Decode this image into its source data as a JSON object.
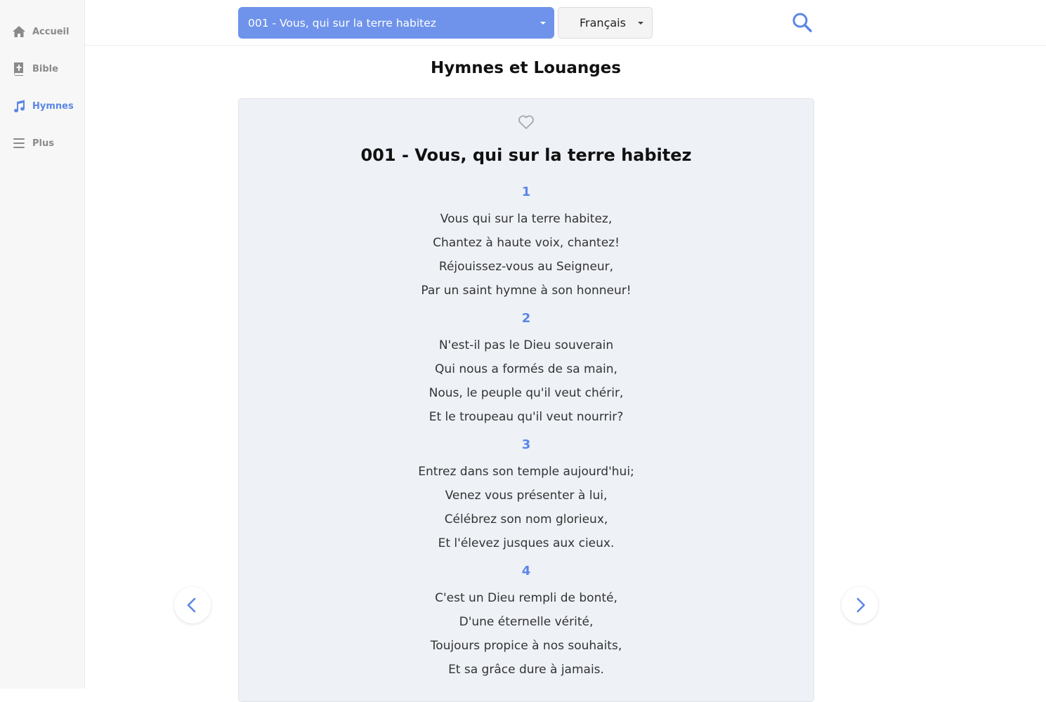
{
  "sidebar": {
    "items": [
      {
        "label": "Accueil",
        "icon": "home-icon",
        "active": false
      },
      {
        "label": "Bible",
        "icon": "bible-icon",
        "active": false
      },
      {
        "label": "Hymnes",
        "icon": "music-note-icon",
        "active": true
      },
      {
        "label": "Plus",
        "icon": "menu-icon",
        "active": false
      }
    ]
  },
  "topbar": {
    "hymn_select_value": "001 - Vous, qui sur la terre habitez",
    "language_select_value": "Français",
    "search_icon": "search-icon"
  },
  "page": {
    "title": "Hymnes et Louanges"
  },
  "hymn": {
    "favorite_icon": "heart-outline-icon",
    "title": "001 - Vous, qui sur la terre habitez",
    "verses": [
      {
        "number": "1",
        "lines": [
          "Vous qui sur la terre habitez,",
          "Chantez à haute voix, chantez!",
          "Réjouissez-vous au Seigneur,",
          "Par un saint hymne à son honneur!"
        ]
      },
      {
        "number": "2",
        "lines": [
          "N'est-il pas le Dieu souverain",
          "Qui nous a formés de sa main,",
          "Nous, le peuple qu'il veut chérir,",
          "Et le troupeau qu'il veut nourrir?"
        ]
      },
      {
        "number": "3",
        "lines": [
          "Entrez dans son temple aujourd'hui;",
          "Venez vous présenter à lui,",
          "Célébrez son nom glorieux,",
          "Et l'élevez jusques aux cieux."
        ]
      },
      {
        "number": "4",
        "lines": [
          "C'est un Dieu rempli de bonté,",
          "D'une éternelle vérité,",
          "Toujours propice à nos souhaits,",
          "Et sa grâce dure à jamais."
        ]
      }
    ]
  },
  "navigation": {
    "prev_icon": "chevron-left-icon",
    "next_icon": "chevron-right-icon"
  },
  "colors": {
    "accent": "#5b86e5",
    "select_bg": "#6f93eb",
    "card_bg": "#eef1f6",
    "sidebar_bg": "#f7f7f7"
  }
}
